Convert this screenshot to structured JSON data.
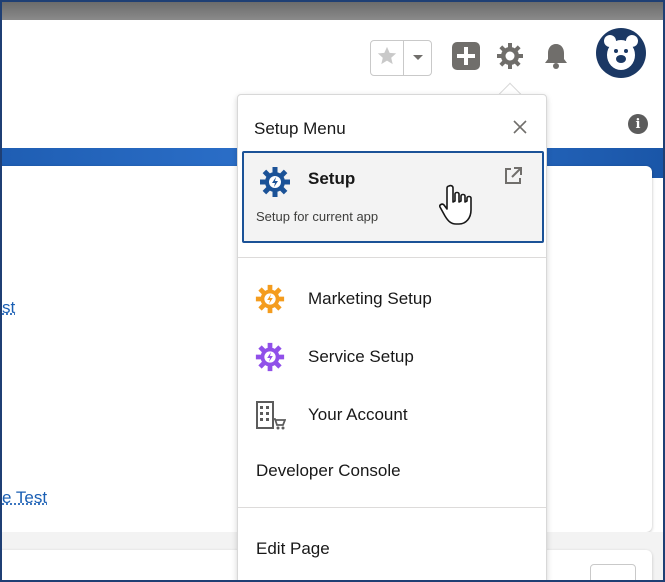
{
  "header": {
    "icons": {
      "favorite": "star-icon",
      "favorites_menu": "chevron-down-icon",
      "global_actions": "plus-icon",
      "setup": "gear-icon",
      "notifications": "bell-icon",
      "avatar": "bear-avatar-icon"
    }
  },
  "background": {
    "link_fragment_1": "st",
    "link_fragment_2": "e Test"
  },
  "setup_menu": {
    "title": "Setup Menu",
    "primary": {
      "label": "Setup",
      "sublabel": "Setup for current app",
      "icon_color": "#1b5297"
    },
    "items": [
      {
        "label": "Marketing Setup",
        "icon": "gear-icon",
        "icon_color": "#f49c1e"
      },
      {
        "label": "Service Setup",
        "icon": "gear-icon",
        "icon_color": "#9050e9"
      },
      {
        "label": "Your Account",
        "icon": "building-cart-icon",
        "icon_color": "#5c5c5c"
      }
    ],
    "developer_console": "Developer Console",
    "edit_page": "Edit Page"
  },
  "colors": {
    "brand_band": "#2f74cf",
    "frame": "#1f3f74",
    "link": "#1a5fb4"
  }
}
